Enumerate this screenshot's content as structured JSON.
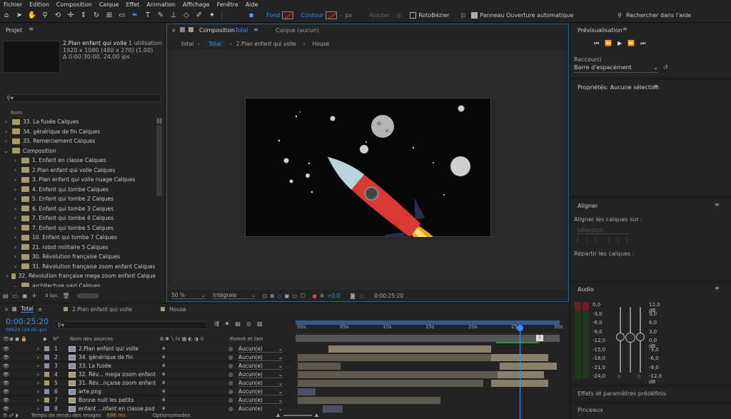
{
  "menu": [
    "Fichier",
    "Edition",
    "Composition",
    "Calque",
    "Effet",
    "Animation",
    "Affichage",
    "Fenêtre",
    "Aide"
  ],
  "toolbar": {
    "fond": "Fond",
    "contour": "Contour",
    "px": "px",
    "ajouter": "Ajouter :",
    "rotobezier": "RotoBézier",
    "panneau": "Panneau Ouverture automatique",
    "search_placeholder": "Rechercher dans l'aide"
  },
  "project": {
    "title": "Projet",
    "item_name": "2.Plan enfant qui volle",
    "item_usage": ", 1 utilisation",
    "item_res": "1920 x 1080  (480 x 270) (1,00)",
    "item_dur": "Δ 0:00:30:00, 24,00 ips",
    "col_nom": "Nom",
    "bpc": "8 bpc",
    "items": [
      {
        "label": "33. La fusée Calques",
        "type": "folder",
        "indent": 0,
        "open": false
      },
      {
        "label": "34. générique de fin Calques",
        "type": "folder",
        "indent": 0,
        "open": false
      },
      {
        "label": "35. Remerciement Calques",
        "type": "folder",
        "indent": 0,
        "open": false
      },
      {
        "label": "Composition",
        "type": "folder",
        "indent": 0,
        "open": true
      },
      {
        "label": "1. Enfant en classe Calques",
        "type": "folder",
        "indent": 1,
        "open": false
      },
      {
        "label": "2.Plan enfant qui volle Calques",
        "type": "folder",
        "indent": 1,
        "open": false
      },
      {
        "label": "3. Plan enfant qui volle nuage Calques",
        "type": "folder",
        "indent": 1,
        "open": false
      },
      {
        "label": "4. Enfant qui tombe Calques",
        "type": "folder",
        "indent": 1,
        "open": false
      },
      {
        "label": "5. Enfant qui tombe 2 Calques",
        "type": "folder",
        "indent": 1,
        "open": false
      },
      {
        "label": "6. Enfant qui tombe 3 Calques",
        "type": "folder",
        "indent": 1,
        "open": false
      },
      {
        "label": "7. Enfant qui tombe 4 Calques",
        "type": "folder",
        "indent": 1,
        "open": false
      },
      {
        "label": "7. Enfant qui tombe 5 Calques",
        "type": "folder",
        "indent": 1,
        "open": false
      },
      {
        "label": "10. Enfant qui tombe 7 Calques",
        "type": "folder",
        "indent": 1,
        "open": false
      },
      {
        "label": "21. robot militaire 5 Calques",
        "type": "folder",
        "indent": 1,
        "open": false
      },
      {
        "label": "30. Révolution française Calques",
        "type": "folder",
        "indent": 1,
        "open": false
      },
      {
        "label": "31. Révolution française zoom enfant Calques",
        "type": "folder",
        "indent": 1,
        "open": false
      },
      {
        "label": "32. Révolution française mega zoom enfant Calque",
        "type": "folder",
        "indent": 1,
        "open": false
      },
      {
        "label": "architecture nazi Calques",
        "type": "folder",
        "indent": 1,
        "open": true
      }
    ]
  },
  "viewer": {
    "tab_prefix": "Composition",
    "tab_name": "Total",
    "calque": "Calque (aucun)",
    "crumbs": [
      "total",
      "Total",
      "2.Plan enfant qui volle",
      "House"
    ],
    "zoom": "50 %",
    "quality": "Intégrale",
    "exposure": "+0,0",
    "time": "0:00:25:20"
  },
  "preview": {
    "title": "Prévisualisation",
    "raccourci": "Raccourci",
    "shortcut": "Barre d'espacement"
  },
  "props": {
    "title": "Propriétés: Aucune sélection"
  },
  "align": {
    "title": "Aligner",
    "on": "Aligner les calques sur :",
    "selection": "Sélection",
    "distribute": "Répartir les calques :"
  },
  "audio": {
    "title": "Audio",
    "left": [
      "0,0",
      "-3,0",
      "-6,0",
      "-9,0",
      "-12,0",
      "-15,0",
      "-18,0",
      "-21,0",
      "-24,0"
    ],
    "right": [
      "12,0 dB",
      "9,0",
      "6,0",
      "3,0",
      "0,0 dB",
      "-3,0",
      "-6,0",
      "-9,0",
      "-12,0 dB"
    ],
    "zero": "0",
    "zero2": "0"
  },
  "effects": "Effets et paramètres prédéfinis",
  "pinceaux": "Pinceaux",
  "timeline": {
    "tabs": [
      "Total",
      "2.Plan enfant qui volle",
      "House"
    ],
    "timecode": "0:00:25:20",
    "timecode_sub": "00620 (24,00 ips)",
    "col_n": "N°",
    "col_src": "Nom des sources",
    "col_parent": "Parent et lien",
    "ticks": [
      "00s",
      "05s",
      "10s",
      "15s",
      "20s",
      "25s",
      "30s"
    ],
    "layers": [
      {
        "n": "1",
        "name": "2.Plan enfant qui volle",
        "color": "#8a8fa6",
        "parent": "Aucun(e)"
      },
      {
        "n": "2",
        "name": "34. générique de fin",
        "color": "#8a8fa6",
        "parent": "Aucun(e)"
      },
      {
        "n": "3",
        "name": "33. La fusée",
        "color": "#8a8fa6",
        "parent": "Aucun(e)"
      },
      {
        "n": "4",
        "name": "32. Rév... mega zoom enfant",
        "color": "#a99a6e",
        "parent": "Aucun(e)"
      },
      {
        "n": "5",
        "name": "31. Rév...nçaise zoom enfant",
        "color": "#a99a6e",
        "parent": "Aucun(e)"
      },
      {
        "n": "6",
        "name": "arte.png",
        "color": "#8a8fa6",
        "parent": "Aucun(e)"
      },
      {
        "n": "7",
        "name": "Bonne nuit les petits",
        "color": "#a99a6e",
        "parent": "Aucun(e)"
      },
      {
        "n": "8",
        "name": "enfant ...nfant en classe.psd",
        "color": "#8a8fa6",
        "parent": "Aucun(e)"
      }
    ],
    "render_label": "Temps de rendu des images",
    "render_value": "686 ms",
    "options": "Options/modes"
  }
}
